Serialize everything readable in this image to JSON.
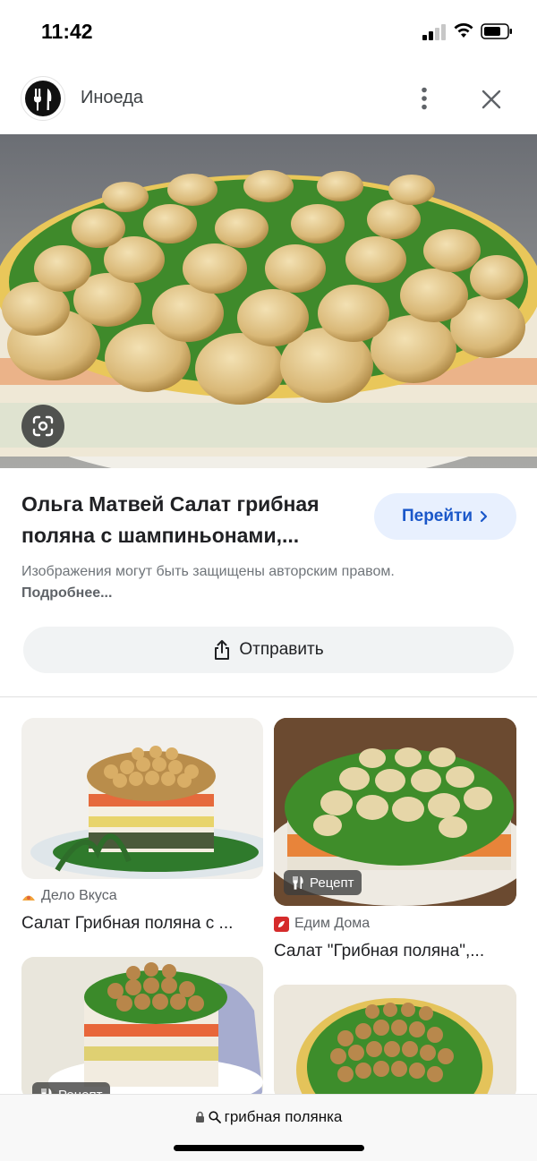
{
  "status_bar": {
    "time": "11:42"
  },
  "header": {
    "source_name": "Иноеда"
  },
  "result": {
    "title": "Ольга Матвей Салат грибная поляна с шампиньонами,...",
    "visit_label": "Перейти",
    "notice_text": "Изображения могут быть защищены авторским правом.",
    "notice_more": "Подробнее...",
    "share_label": "Отправить"
  },
  "related": [
    {
      "source": "Дело Вкуса",
      "title": "Салат Грибная поляна с ..."
    },
    {
      "badge": "Рецепт",
      "source": "Едим Дома",
      "title": "Салат \"Грибная поляна\",..."
    },
    {
      "badge": "Рецепт"
    },
    {}
  ],
  "address_bar": {
    "query": "грибная полянка"
  },
  "colors": {
    "accent_blue": "#1a57c9",
    "pill_blue": "#e8f0fe",
    "pill_gray": "#f1f3f4",
    "muted_text": "#70757a"
  }
}
